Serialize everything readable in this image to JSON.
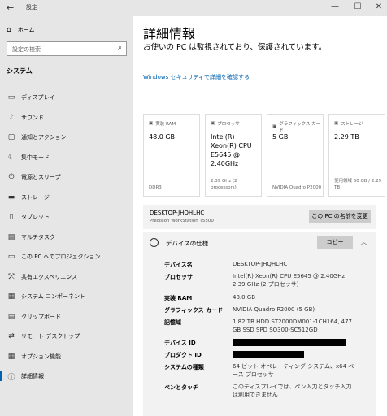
{
  "window": {
    "title": "設定",
    "minimize": "—",
    "maximize": "☐",
    "close": "✕"
  },
  "sidebar": {
    "home": "ホーム",
    "search_placeholder": "設定の検索",
    "section": "システム",
    "items": [
      {
        "label": "ディスプレイ",
        "icon": "display-icon"
      },
      {
        "label": "サウンド",
        "icon": "sound-icon"
      },
      {
        "label": "通知とアクション",
        "icon": "notification-icon"
      },
      {
        "label": "集中モード",
        "icon": "focus-icon"
      },
      {
        "label": "電源とスリープ",
        "icon": "power-icon"
      },
      {
        "label": "ストレージ",
        "icon": "storage-icon"
      },
      {
        "label": "タブレット",
        "icon": "tablet-icon"
      },
      {
        "label": "マルチタスク",
        "icon": "multitask-icon"
      },
      {
        "label": "この PC へのプロジェクション",
        "icon": "projection-icon"
      },
      {
        "label": "共有エクスペリエンス",
        "icon": "shared-icon"
      },
      {
        "label": "システム コンポーネント",
        "icon": "components-icon"
      },
      {
        "label": "クリップボード",
        "icon": "clipboard-icon"
      },
      {
        "label": "リモート デスクトップ",
        "icon": "remote-icon"
      },
      {
        "label": "オプション機能",
        "icon": "options-icon"
      },
      {
        "label": "詳細情報",
        "icon": "info-icon"
      }
    ],
    "active_index": 14
  },
  "main": {
    "title": "詳細情報",
    "notice": "お使いの PC は監視されており、保護されています。",
    "link": "Windows セキュリティで詳細を確認する",
    "cards": [
      {
        "header": "実装 RAM",
        "value": "48.0 GB",
        "sub": "DDR3"
      },
      {
        "header": "プロセッサ",
        "value": "Intel(R) Xeon(R) CPU E5645 @ 2.40GHz",
        "sub": "2.39 GHz (2 processors)"
      },
      {
        "header": "グラフィックス カード",
        "value": "5 GB",
        "sub": "NVIDIA Quadro P2000"
      },
      {
        "header": "ストレージ",
        "value": "2.29 TB",
        "sub": "使用領域 60 GB / 2.29 TB"
      }
    ],
    "device_name": "DESKTOP-JHQHLHC",
    "device_model": "Precision WorkStation T5500",
    "rename_button": "この PC の名前を変更",
    "spec_title": "デバイスの仕様",
    "copy_button": "コピー",
    "specs": {
      "device_name": {
        "k": "デバイス名",
        "v": "DESKTOP-JHQHLHC"
      },
      "processor": {
        "k": "プロセッサ",
        "v": "Intel(R) Xeon(R) CPU E5645 @ 2.40GHz 2.39 GHz (2 プロセッサ)"
      },
      "ram": {
        "k": "実装 RAM",
        "v": "48.0 GB"
      },
      "gpu": {
        "k": "グラフィックス カード",
        "v": "NVIDIA Quadro P2000 (5 GB)"
      },
      "storage": {
        "k": "記憶域",
        "v": "1.82 TB HDD ST2000DM001-1CH164, 477 GB SSD SPD SQ300-SC512GD"
      },
      "device_id": {
        "k": "デバイス ID"
      },
      "product_id": {
        "k": "プロダクト ID"
      },
      "system_type": {
        "k": "システムの種類",
        "v": "64 ビット オペレーティング システム、x64 ベース プロセッサ"
      },
      "pen": {
        "k": "ペンとタッチ",
        "v": "このディスプレイでは、ペン入力とタッチ入力は利用できません"
      }
    }
  }
}
